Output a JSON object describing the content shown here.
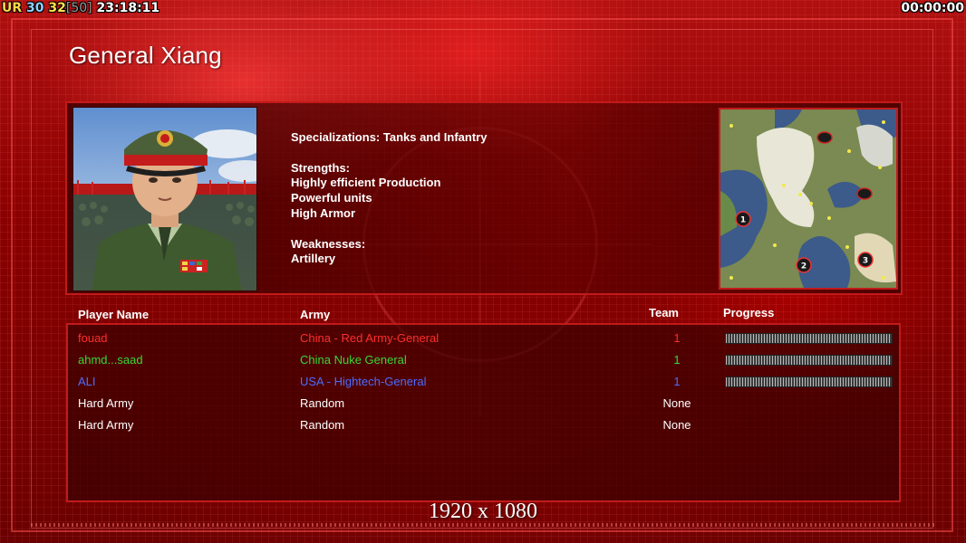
{
  "hud": {
    "ur": "UR",
    "fps": "30",
    "logic": "32",
    "limit": "[50]",
    "clock": "23:18:11",
    "timer": "00:00:00"
  },
  "general": {
    "name": "General Xiang",
    "spec_line": "Specializations: Tanks and Infantry",
    "strengths_title": "Strengths:",
    "strengths": [
      "Highly efficient Production",
      "Powerful units",
      "High Armor"
    ],
    "weaknesses_title": "Weaknesses:",
    "weaknesses": [
      "Artillery"
    ]
  },
  "minimap": {
    "start_positions": [
      "1",
      "2",
      "3"
    ]
  },
  "table": {
    "headers": {
      "player": "Player Name",
      "army": "Army",
      "team": "Team",
      "progress": "Progress"
    },
    "rows": [
      {
        "name": "fouad",
        "army": "China - Red Army-General",
        "team": "1",
        "color": "#ff2d2d",
        "progress": 1.0
      },
      {
        "name": "ahmd...saad",
        "army": "China Nuke General",
        "team": "1",
        "color": "#38d838",
        "progress": 1.0
      },
      {
        "name": "ALI",
        "army": "USA - Hightech-General",
        "team": "1",
        "color": "#4c6dff",
        "progress": 1.0
      },
      {
        "name": "Hard Army",
        "army": "Random",
        "team": "None",
        "color": "#ffffff"
      },
      {
        "name": "Hard Army",
        "army": "Random",
        "team": "None",
        "color": "#ffffff"
      }
    ]
  },
  "resolution": "1920 x 1080"
}
